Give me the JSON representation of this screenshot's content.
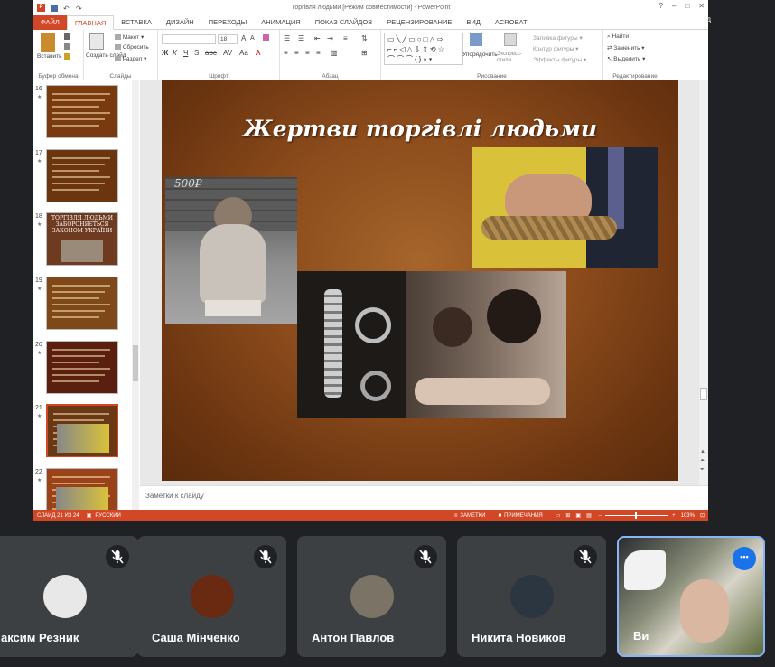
{
  "window": {
    "title": "Торгівля людьми [Режим совместимости] - PowerPoint",
    "account": "Вход"
  },
  "tabs": [
    "ФАЙЛ",
    "ГЛАВНАЯ",
    "ВСТАВКА",
    "ДИЗАЙН",
    "ПЕРЕХОДЫ",
    "АНИМАЦИЯ",
    "ПОКАЗ СЛАЙДОВ",
    "РЕЦЕНЗИРОВАНИЕ",
    "ВИД",
    "ACROBAT"
  ],
  "ribbon": {
    "paste": "Вставить",
    "new_slide": "Создать слайд",
    "layout": "Макет",
    "reset": "Сбросить",
    "section": "Раздел",
    "font_size": "18",
    "arrange": "Упорядочить",
    "quick_styles": "Экспресс-стили",
    "shape_fill": "Заливка фигуры",
    "shape_outline": "Контур фигуры",
    "shape_effects": "Эффекты фигуры",
    "find": "Найти",
    "replace": "Заменить",
    "select": "Выделить",
    "groups": {
      "clipboard": "Буфер обмена",
      "slides": "Слайды",
      "font": "Шрифт",
      "paragraph": "Абзац",
      "drawing": "Рисование",
      "editing": "Редактирование"
    }
  },
  "thumbnails": [
    {
      "num": "16",
      "caption": ""
    },
    {
      "num": "17",
      "caption": ""
    },
    {
      "num": "18",
      "caption": "ТОРГІВЛЯ ЛЮДЬМИ ЗАБОРОНЯЄТЬСЯ ЗАКОНОМ УКРАЇНИ"
    },
    {
      "num": "19",
      "caption": ""
    },
    {
      "num": "20",
      "caption": ""
    },
    {
      "num": "21",
      "caption": ""
    },
    {
      "num": "22",
      "caption": ""
    }
  ],
  "slide": {
    "title": "Жертви торгівлі людьми",
    "sign_text": "500₽"
  },
  "notes_placeholder": "Заметки к слайду",
  "status": {
    "slide_info": "СЛАЙД 21 ИЗ 24",
    "language": "РУССКИЙ",
    "notes": "ЗАМЕТКИ",
    "comments": "ПРИМЕЧАНИЯ",
    "zoom": "103%"
  },
  "participants": [
    {
      "name": "Максим Резник",
      "muted": true
    },
    {
      "name": "Саша Мінченко",
      "muted": true
    },
    {
      "name": "Антон Павлов",
      "muted": true
    },
    {
      "name": "Никита Новиков",
      "muted": true
    },
    {
      "name": "Ви",
      "muted": false
    }
  ],
  "colors": {
    "accent": "#d24726",
    "meet_bg": "#202124",
    "tile_bg": "#3c4043",
    "active_border": "#8ab4f8"
  }
}
